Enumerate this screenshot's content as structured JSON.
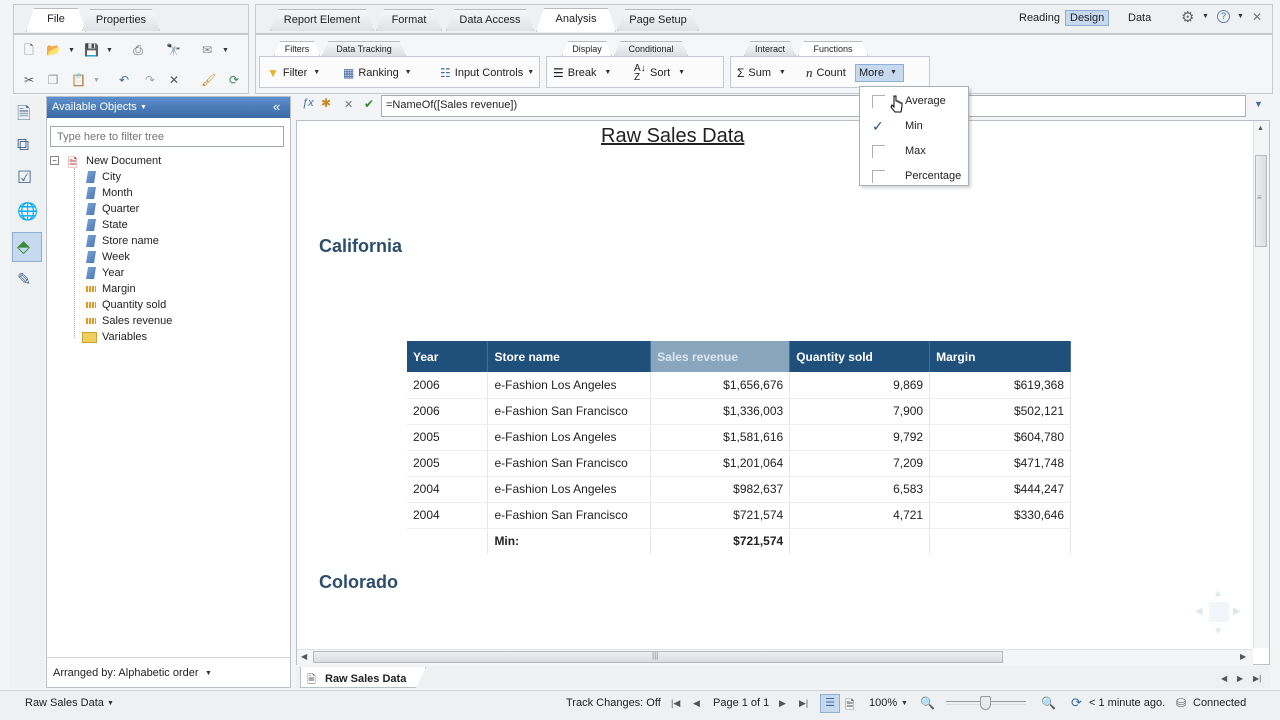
{
  "top_tabs_left": [
    "File",
    "Properties"
  ],
  "top_tabs_main": [
    "Report Element",
    "Format",
    "Data Access",
    "Analysis",
    "Page Setup"
  ],
  "view_modes": {
    "reading": "Reading",
    "design": "Design",
    "data": "Data"
  },
  "subtabs": {
    "filters": "Filters",
    "data_tracking": "Data Tracking",
    "display": "Display",
    "conditional": "Conditional",
    "interact": "Interact",
    "functions": "Functions"
  },
  "toolbar": {
    "filter": "Filter",
    "ranking": "Ranking",
    "input_controls": "Input Controls",
    "break": "Break",
    "sort": "Sort",
    "sum": "Sum",
    "count": "Count",
    "more": "More"
  },
  "more_menu": {
    "items": [
      {
        "label": "Average",
        "checked": false
      },
      {
        "label": "Min",
        "checked": true
      },
      {
        "label": "Max",
        "checked": false
      },
      {
        "label": "Percentage",
        "checked": false
      }
    ]
  },
  "available_objects": {
    "title": "Available Objects",
    "filter_placeholder": "Type here to filter tree",
    "root": "New Document",
    "items": [
      {
        "label": "City",
        "kind": "dimension"
      },
      {
        "label": "Month",
        "kind": "dimension"
      },
      {
        "label": "Quarter",
        "kind": "dimension"
      },
      {
        "label": "State",
        "kind": "dimension"
      },
      {
        "label": "Store name",
        "kind": "dimension"
      },
      {
        "label": "Week",
        "kind": "dimension"
      },
      {
        "label": "Year",
        "kind": "dimension"
      },
      {
        "label": "Margin",
        "kind": "measure"
      },
      {
        "label": "Quantity sold",
        "kind": "measure"
      },
      {
        "label": "Sales revenue",
        "kind": "measure"
      },
      {
        "label": "Variables",
        "kind": "folder"
      }
    ],
    "arranged_by": "Arranged by: Alphabetic order"
  },
  "formula": "=NameOf([Sales revenue])",
  "report": {
    "title": "Raw Sales Data",
    "section1": "California",
    "section2": "Colorado",
    "columns": [
      "Year",
      "Store name",
      "Sales revenue",
      "Quantity sold",
      "Margin"
    ],
    "rows": [
      [
        "2006",
        "e-Fashion Los Angeles",
        "$1,656,676",
        "9,869",
        "$619,368"
      ],
      [
        "2006",
        "e-Fashion San Francisco",
        "$1,336,003",
        "7,900",
        "$502,121"
      ],
      [
        "2005",
        "e-Fashion Los Angeles",
        "$1,581,616",
        "9,792",
        "$604,780"
      ],
      [
        "2005",
        "e-Fashion San Francisco",
        "$1,201,064",
        "7,209",
        "$471,748"
      ],
      [
        "2004",
        "e-Fashion Los Angeles",
        "$982,637",
        "6,583",
        "$444,247"
      ],
      [
        "2004",
        "e-Fashion San Francisco",
        "$721,574",
        "4,721",
        "$330,646"
      ]
    ],
    "footer_label": "Min:",
    "footer_value": "$721,574"
  },
  "report_tab": "Raw Sales Data",
  "status": {
    "doc_name": "Raw Sales Data",
    "track_changes": "Track Changes: Off",
    "page": "Page 1 of 1",
    "zoom": "100%",
    "refresh": "< 1 minute ago.",
    "connection": "Connected"
  },
  "colors": {
    "header_bg": "#1f4f7b",
    "section_title": "#2e4d6b",
    "accent": "#3a6fb0"
  }
}
